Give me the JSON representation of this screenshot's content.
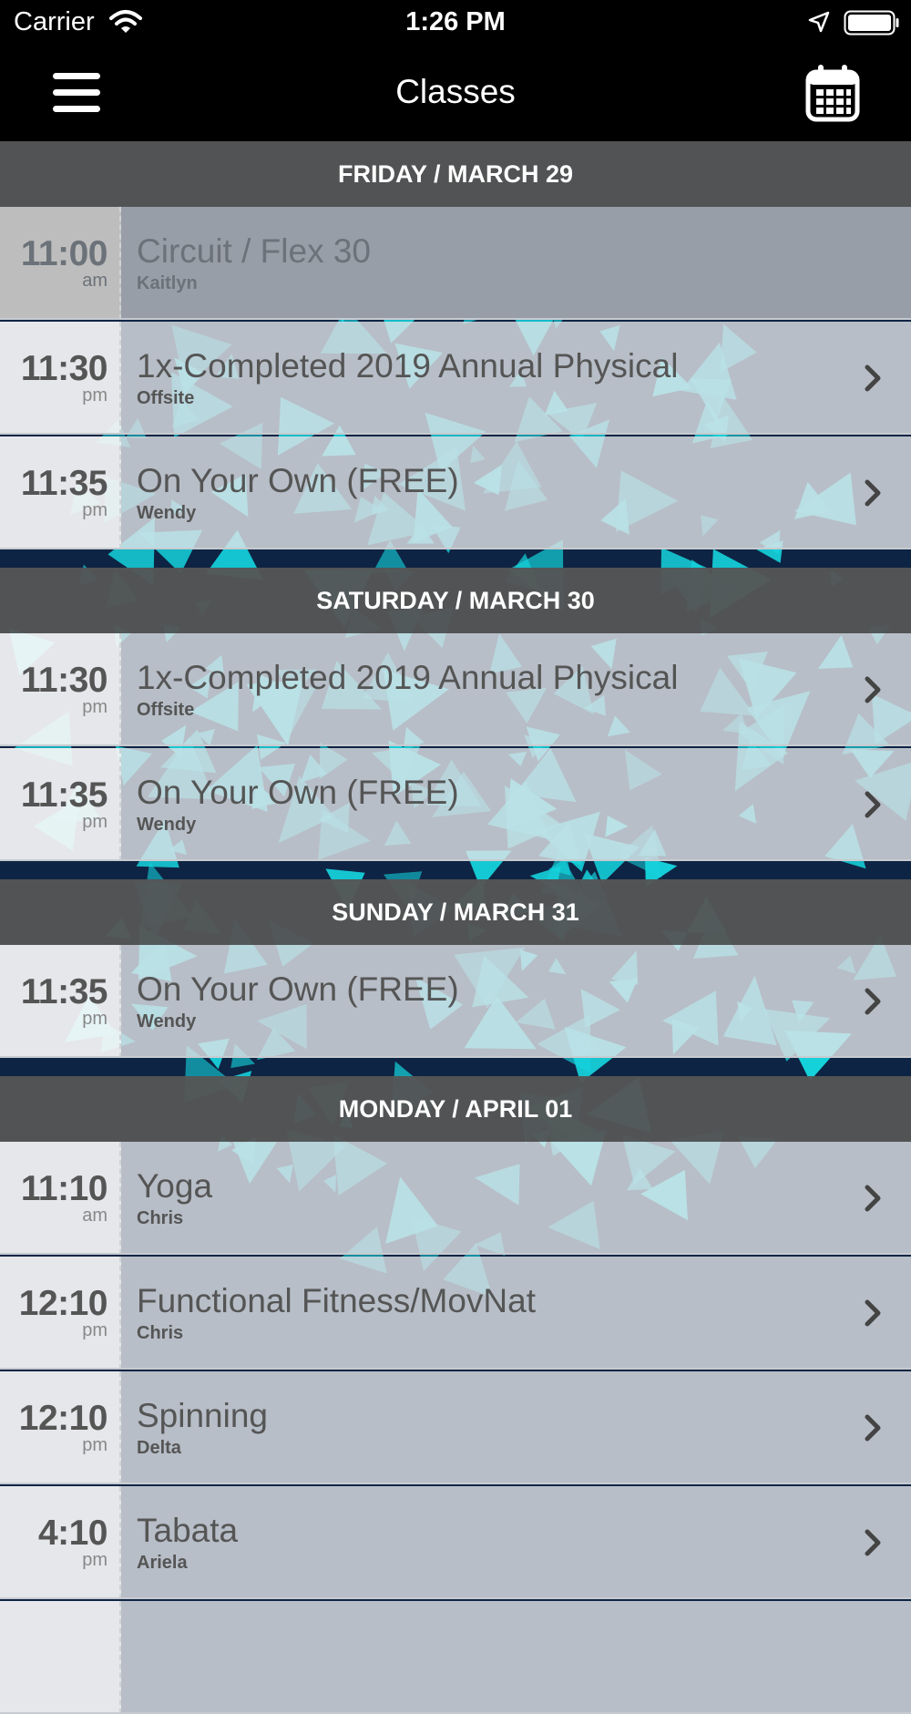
{
  "status_bar": {
    "carrier": "Carrier",
    "time": "1:26 PM"
  },
  "nav": {
    "title": "Classes",
    "menu_icon": "hamburger-menu-icon",
    "calendar_icon": "calendar-icon"
  },
  "colors": {
    "header_bg": "#555555",
    "nav_bg": "#000000",
    "background": "#0e2444",
    "accent": "#15d3dc",
    "past_row": "#979ea7"
  },
  "days": [
    {
      "label": "FRIDAY / MARCH 29",
      "classes": [
        {
          "time": "11:00",
          "ampm": "am",
          "name": "Circuit / Flex 30",
          "instructor": "Kaitlyn",
          "past": true
        },
        {
          "time": "11:30",
          "ampm": "pm",
          "name": "1x-Completed 2019 Annual Physical",
          "instructor": "Offsite"
        },
        {
          "time": "11:35",
          "ampm": "pm",
          "name": "On Your Own (FREE)",
          "instructor": "Wendy"
        }
      ]
    },
    {
      "label": "SATURDAY / MARCH 30",
      "classes": [
        {
          "time": "11:30",
          "ampm": "pm",
          "name": "1x-Completed 2019 Annual Physical",
          "instructor": "Offsite"
        },
        {
          "time": "11:35",
          "ampm": "pm",
          "name": "On Your Own (FREE)",
          "instructor": "Wendy"
        }
      ]
    },
    {
      "label": "SUNDAY / MARCH 31",
      "classes": [
        {
          "time": "11:35",
          "ampm": "pm",
          "name": "On Your Own (FREE)",
          "instructor": "Wendy"
        }
      ]
    },
    {
      "label": "MONDAY / APRIL 01",
      "classes": [
        {
          "time": "11:10",
          "ampm": "am",
          "name": "Yoga",
          "instructor": "Chris"
        },
        {
          "time": "12:10",
          "ampm": "pm",
          "name": "Functional Fitness/MovNat",
          "instructor": "Chris"
        },
        {
          "time": "12:10",
          "ampm": "pm",
          "name": "Spinning",
          "instructor": "Delta"
        },
        {
          "time": "4:10",
          "ampm": "pm",
          "name": "Tabata",
          "instructor": "Ariela"
        },
        {
          "time": "",
          "ampm": "",
          "name": "",
          "instructor": ""
        }
      ]
    }
  ]
}
